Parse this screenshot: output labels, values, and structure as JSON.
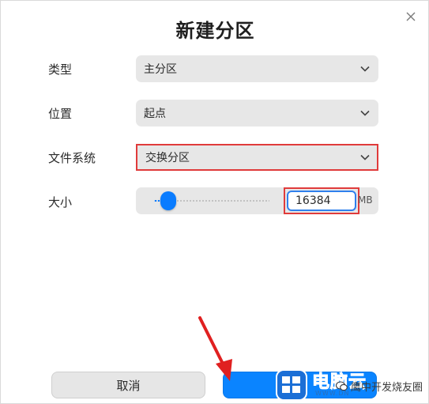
{
  "dialog": {
    "title": "新建分区",
    "close_icon": "close-icon"
  },
  "form": {
    "type": {
      "label": "类型",
      "value": "主分区"
    },
    "position": {
      "label": "位置",
      "value": "起点"
    },
    "filesystem": {
      "label": "文件系统",
      "value": "交换分区"
    },
    "size": {
      "label": "大小",
      "value": "16384",
      "unit": "MB",
      "slider_fraction": 0.12
    }
  },
  "buttons": {
    "cancel": "取消",
    "create": ""
  },
  "annotations": {
    "highlight_color": "#e03b3b",
    "arrow_color": "#e02020"
  },
  "watermark": {
    "brand": "电脑云",
    "url": "WWW.DN",
    "label": "鹰中开发烧友圈"
  },
  "colors": {
    "accent": "#0a84ff",
    "field_bg": "#e7e7e7"
  }
}
